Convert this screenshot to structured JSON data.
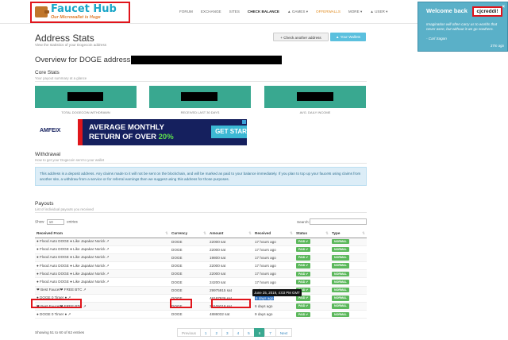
{
  "logo": {
    "title": "Faucet Hub",
    "subtitle": "Our Microwallet is Huge"
  },
  "nav": {
    "items": [
      {
        "label": "FORUM"
      },
      {
        "label": "EXCHANGE"
      },
      {
        "label": "SITES"
      },
      {
        "label": "CHECK BALANCE"
      },
      {
        "label": "▲ GAMES ▾"
      },
      {
        "label": "OFFERWALLS"
      },
      {
        "label": "MORE ▾"
      },
      {
        "label": "▲ USER ▾"
      }
    ]
  },
  "header": {
    "title": "Address Stats",
    "subtitle": "View the statistics of your Dogecoin address",
    "check_btn": "+ Check another address",
    "wallets_btn": "▲ Your Wallets",
    "overview": "Overview for DOGE address"
  },
  "core": {
    "title": "Core Stats",
    "subtitle": "Your payout summary at a glance",
    "labels": [
      "TOTAL DOGECOIN WITHDRAWN",
      "RECEIVED LAST 30 DAYS",
      "AVG. DAILY INCOME"
    ]
  },
  "banner": {
    "logo": "AMFEIX",
    "line1": "AVERAGE MONTHLY",
    "line2_prefix": "RETURN OF OVER ",
    "line2_pct": "20%",
    "cta": "GET STARTED"
  },
  "withdrawal": {
    "title": "Withdrawal",
    "subtitle": "How to get your Dogecoin sent to your wallet",
    "notice": "This address is a deposit address. Any claims made to it will not be sent on the blockchain, and will be marked as paid to your balance immediately. If you plan to top up your faucets using claims from another site, a withdraw from a service or for referral earnings then we suggest using this address for those purposes."
  },
  "payouts": {
    "title": "Payouts",
    "subtitle": "List of individual payouts you received",
    "show_label": "Show",
    "show_value": "10",
    "entries_label": "entries",
    "search_label": "Search:",
    "columns": [
      "Received From",
      "Currency",
      "Amount",
      "Received",
      "Status",
      "Type"
    ],
    "rows": [
      {
        "from": "● Flood Auto DOGE ● Like Japakar Norick ↗",
        "currency": "DOGE",
        "amount": "22000 sat",
        "received": "17 hours ago",
        "status": "PAID ✔",
        "type": "NORMAL"
      },
      {
        "from": "● Flood Auto DOGE ● Like Japakar Norick ↗",
        "currency": "DOGE",
        "amount": "22000 sat",
        "received": "17 hours ago",
        "status": "PAID ✔",
        "type": "NORMAL"
      },
      {
        "from": "● Flood Auto DOGE ● Like Japakar Norick ↗",
        "currency": "DOGE",
        "amount": "19800 sat",
        "received": "17 hours ago",
        "status": "PAID ✔",
        "type": "NORMAL"
      },
      {
        "from": "● Flood Auto DOGE ● Like Japakar Norick ↗",
        "currency": "DOGE",
        "amount": "22000 sat",
        "received": "17 hours ago",
        "status": "PAID ✔",
        "type": "NORMAL"
      },
      {
        "from": "● Flood Auto DOGE ● Like Japakar Norick ↗",
        "currency": "DOGE",
        "amount": "22000 sat",
        "received": "17 hours ago",
        "status": "PAID ✔",
        "type": "NORMAL"
      },
      {
        "from": "● Flood Auto DOGE ● Like Japakar Norick ↗",
        "currency": "DOGE",
        "amount": "24200 sat",
        "received": "17 hours ago",
        "status": "PAID ✔",
        "type": "NORMAL"
      },
      {
        "from": "❤ Best Faucet❤ FREE BTC ↗",
        "currency": "DOGE",
        "amount": "29975915 sat",
        "received": "6 days ago",
        "status": "PAID ✔",
        "type": "NORMAL"
      },
      {
        "from": "● DOGE 0 Timer ● ↗",
        "currency": "DOGE",
        "amount": "48187926 sat",
        "received": "6 days ago",
        "status": "PAID ✔",
        "type": "NORMAL"
      },
      {
        "from": "❤ Best Faucet❤ FREE BTC ↗",
        "currency": "DOGE",
        "amount": "30109218 sat",
        "received": "6 days ago",
        "status": "PAID ✔",
        "type": "NORMAL"
      },
      {
        "from": "● DOGE 0 Timer ● ↗",
        "currency": "DOGE",
        "amount": "4886032 sat",
        "received": "9 days ago",
        "status": "PAID ✔",
        "type": "NORMAL"
      }
    ],
    "tooltip": "June 25, 2019, 4:03 PM GMT",
    "info": "Showing 51 to 60 of 62 entries",
    "pager": [
      "Previous",
      "1",
      "2",
      "3",
      "4",
      "5",
      "6",
      "7",
      "Next"
    ],
    "active_page": "6"
  },
  "toast": {
    "title": "Welcome back",
    "user": "cjcreddi!",
    "close": "×",
    "quote": "Imagination will often carry us to worlds that never were, but without it we go nowhere.",
    "author": "- Carl Sagan",
    "time": "37m ago"
  },
  "colors": {
    "accent": "#39a890",
    "highlight": "#e0141b",
    "toast": "#5ab0c8",
    "badge": "#5cb85c"
  }
}
